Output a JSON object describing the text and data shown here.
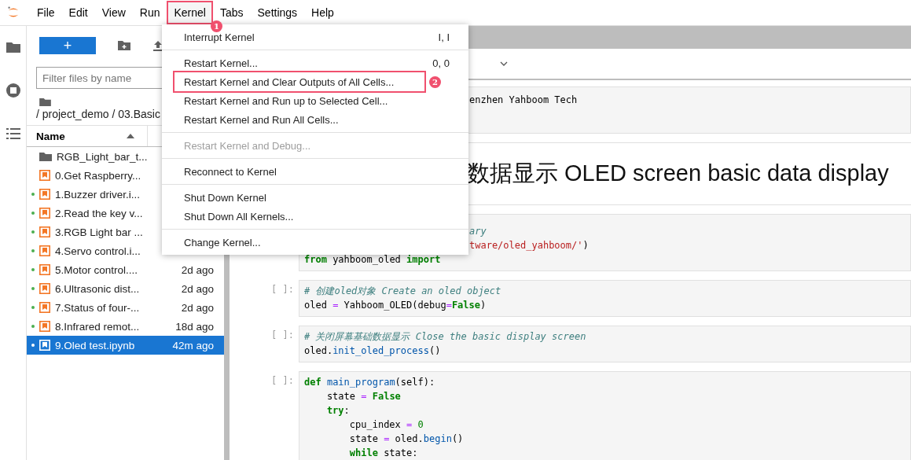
{
  "menubar": [
    {
      "label": "File",
      "selected": false
    },
    {
      "label": "Edit",
      "selected": false
    },
    {
      "label": "View",
      "selected": false
    },
    {
      "label": "Run",
      "selected": false
    },
    {
      "label": "Kernel",
      "selected": true,
      "annotation": "1"
    },
    {
      "label": "Tabs",
      "selected": false
    },
    {
      "label": "Settings",
      "selected": false
    },
    {
      "label": "Help",
      "selected": false
    }
  ],
  "menu": [
    [
      {
        "label": "Interrupt Kernel",
        "shortcut": "I, I",
        "disabled": false
      }
    ],
    [
      {
        "label": "Restart Kernel...",
        "shortcut": "0, 0",
        "disabled": false
      },
      {
        "label": "Restart Kernel and Clear Outputs of All Cells...",
        "disabled": false,
        "annotation": "2"
      },
      {
        "label": "Restart Kernel and Run up to Selected Cell...",
        "disabled": false
      },
      {
        "label": "Restart Kernel and Run All Cells...",
        "disabled": false
      }
    ],
    [
      {
        "label": "Restart Kernel and Debug...",
        "disabled": true
      }
    ],
    [
      {
        "label": "Reconnect to Kernel",
        "disabled": false
      }
    ],
    [
      {
        "label": "Shut Down Kernel",
        "disabled": false
      },
      {
        "label": "Shut Down All Kernels...",
        "disabled": false
      }
    ],
    [
      {
        "label": "Change Kernel...",
        "disabled": false
      }
    ]
  ],
  "file_browser": {
    "new_button": "+",
    "filter": {
      "placeholder": "Filter files by name"
    },
    "breadcrumb": "/ project_demo / 03.Basic",
    "columns": [
      "Name"
    ],
    "files": [
      {
        "kind": "folder",
        "name": "RGB_Light_bar_t...",
        "running": false,
        "selected": false
      },
      {
        "kind": "notebook",
        "name": "0.Get Raspberry...",
        "running": false,
        "selected": false
      },
      {
        "kind": "notebook",
        "name": "1.Buzzer driver.i...",
        "running": true,
        "selected": false
      },
      {
        "kind": "notebook",
        "name": "2.Read the key v...",
        "running": true,
        "selected": false
      },
      {
        "kind": "notebook",
        "name": "3.RGB Light bar ...",
        "running": true,
        "selected": false
      },
      {
        "kind": "notebook",
        "name": "4.Servo control.i...",
        "running": true,
        "selected": false
      },
      {
        "kind": "notebook",
        "name": "5.Motor control....",
        "modified": "2d ago",
        "running": true,
        "selected": false
      },
      {
        "kind": "notebook",
        "name": "6.Ultrasonic dist...",
        "modified": "2d ago",
        "running": true,
        "selected": false
      },
      {
        "kind": "notebook",
        "name": "7.Status of four-...",
        "modified": "2d ago",
        "running": true,
        "selected": false
      },
      {
        "kind": "notebook",
        "name": "8.Infrared remot...",
        "modified": "18d ago",
        "running": true,
        "selected": false
      },
      {
        "kind": "notebook",
        "name": "9.Oled test.ipynb",
        "modified": "42m ago",
        "running": true,
        "selected": true
      }
    ]
  },
  "cells": [
    {
      "kind": "code",
      "lines": [
        {
          "clipped_start": true,
          "tokens": [
            {
              "text": "enzhen Yahboom Tech",
              "kind": "plain"
            }
          ]
        }
      ]
    },
    {
      "kind": "heading",
      "clipped_start": true,
      "text": "数据显示 OLED screen basic data display"
    },
    {
      "kind": "code",
      "lines": [
        {
          "clipped_start": true,
          "tokens": [
            {
              "text": "ary",
              "kind": "comment"
            }
          ]
        },
        {
          "clipped_start": true,
          "tokens": [
            {
              "text": "tware/oled_yahboom/'",
              "kind": "string"
            },
            {
              "text": ")",
              "kind": "plain"
            }
          ]
        },
        {
          "tokens": [
            {
              "text": "from",
              "kind": "keyword"
            },
            {
              "text": " yahboom_oled ",
              "kind": "plain"
            },
            {
              "text": "import",
              "kind": "keyword"
            }
          ]
        }
      ]
    },
    {
      "kind": "code",
      "prompt": "[ ]:",
      "lines": [
        {
          "tokens": [
            {
              "text": "# 创建oled对象 Create an oled object",
              "kind": "comment"
            }
          ]
        },
        {
          "tokens": [
            {
              "text": "oled ",
              "kind": "plain"
            },
            {
              "text": "=",
              "kind": "op"
            },
            {
              "text": " Yahboom_OLED(debug",
              "kind": "plain"
            },
            {
              "text": "=",
              "kind": "op"
            },
            {
              "text": "False",
              "kind": "keyword"
            },
            {
              "text": ")",
              "kind": "plain"
            }
          ]
        }
      ]
    },
    {
      "kind": "code",
      "prompt": "[ ]:",
      "lines": [
        {
          "tokens": [
            {
              "text": "# 关闭屏幕基础数据显示 Close the basic display screen",
              "kind": "comment"
            }
          ]
        },
        {
          "tokens": [
            {
              "text": "oled.",
              "kind": "plain"
            },
            {
              "text": "init_oled_process",
              "kind": "func"
            },
            {
              "text": "()",
              "kind": "plain"
            }
          ]
        }
      ]
    },
    {
      "kind": "code",
      "prompt": "[ ]:",
      "lines": [
        {
          "tokens": [
            {
              "text": "def",
              "kind": "keyword"
            },
            {
              "text": " main_program",
              "kind": "func"
            },
            {
              "text": "(self):",
              "kind": "plain"
            }
          ]
        },
        {
          "tokens": [
            {
              "text": "    state ",
              "kind": "plain"
            },
            {
              "text": "=",
              "kind": "op"
            },
            {
              "text": " False",
              "kind": "keyword"
            }
          ]
        },
        {
          "tokens": [
            {
              "text": "    try",
              "kind": "keyword"
            },
            {
              "text": ":",
              "kind": "plain"
            }
          ]
        },
        {
          "tokens": [
            {
              "text": "        cpu_index ",
              "kind": "plain"
            },
            {
              "text": "=",
              "kind": "op"
            },
            {
              "text": " 0",
              "kind": "number"
            }
          ]
        },
        {
          "tokens": [
            {
              "text": "        state ",
              "kind": "plain"
            },
            {
              "text": "=",
              "kind": "op"
            },
            {
              "text": " oled.",
              "kind": "plain"
            },
            {
              "text": "begin",
              "kind": "func"
            },
            {
              "text": "()",
              "kind": "plain"
            }
          ]
        },
        {
          "tokens": [
            {
              "text": "        while",
              "kind": "keyword"
            },
            {
              "text": " state:",
              "kind": "plain"
            }
          ]
        }
      ]
    }
  ]
}
